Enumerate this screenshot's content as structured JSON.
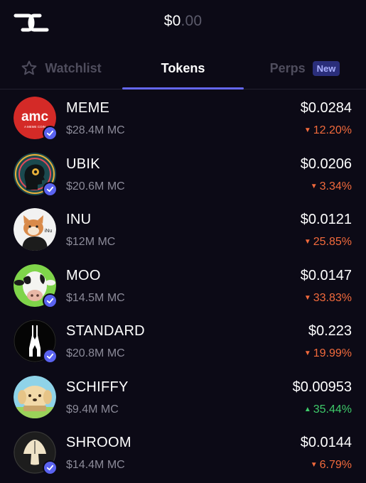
{
  "header": {
    "balance_main": "$0",
    "balance_cents": ".00"
  },
  "tabs": [
    {
      "label": "Watchlist",
      "active": false
    },
    {
      "label": "Tokens",
      "active": true
    },
    {
      "label": "Perps",
      "active": false,
      "badge": "New"
    }
  ],
  "colors": {
    "accent": "#6467f2",
    "down": "#f26a3c",
    "up": "#3ecb6a",
    "background": "#0c0a16",
    "muted": "#8c8b99"
  },
  "tokens": [
    {
      "name": "MEME",
      "mc": "$28.4M MC",
      "price": "$0.0284",
      "change": "12.20%",
      "direction": "down",
      "avatar_text": "amc",
      "avatar_subtext": "A MEME COIN"
    },
    {
      "name": "UBIK",
      "mc": "$20.6M MC",
      "price": "$0.0206",
      "change": "3.34%",
      "direction": "down"
    },
    {
      "name": "INU",
      "mc": "$12M MC",
      "price": "$0.0121",
      "change": "25.85%",
      "direction": "down",
      "avatar_text": "iNu"
    },
    {
      "name": "MOO",
      "mc": "$14.5M MC",
      "price": "$0.0147",
      "change": "33.83%",
      "direction": "down"
    },
    {
      "name": "STANDARD",
      "mc": "$20.8M MC",
      "price": "$0.223",
      "change": "19.99%",
      "direction": "down"
    },
    {
      "name": "SCHIFFY",
      "mc": "$9.4M MC",
      "price": "$0.00953",
      "change": "35.44%",
      "direction": "up"
    },
    {
      "name": "SHROOM",
      "mc": "$14.4M MC",
      "price": "$0.0144",
      "change": "6.79%",
      "direction": "down"
    }
  ]
}
